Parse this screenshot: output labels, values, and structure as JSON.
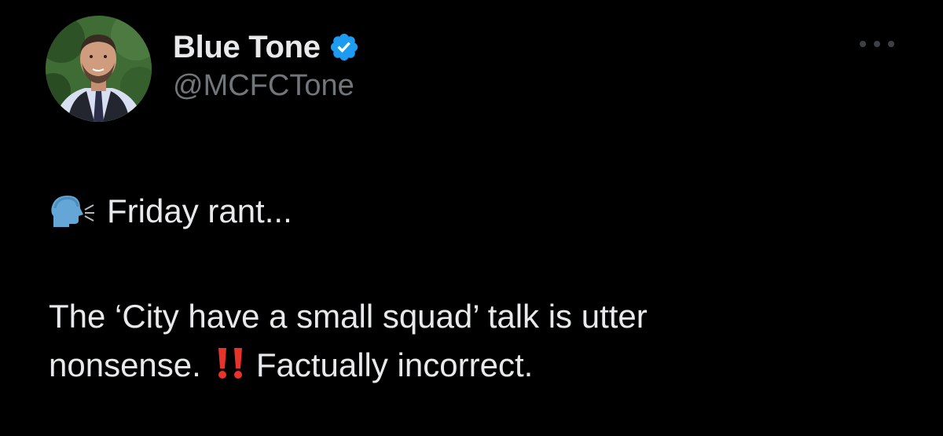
{
  "tweet": {
    "author": {
      "display_name": "Blue Tone",
      "handle": "@MCFCTone",
      "verified": true,
      "avatar_icon": "profile-photo-avatar"
    },
    "more_icon": "ellipsis-icon",
    "text": {
      "line1_emoji": "speaking-head-icon",
      "line1": "Friday rant...",
      "line2": "The ‘City have a small squad’ talk is utter",
      "line3_before": "nonsense.",
      "line3_emoji": "double-exclamation-icon",
      "line3_after": "Factually incorrect."
    }
  },
  "colors": {
    "background": "#000000",
    "text_primary": "#e7e9ea",
    "text_secondary": "#71767b",
    "verified_blue": "#1d9bf0",
    "emoji_red": "#e8332b"
  }
}
